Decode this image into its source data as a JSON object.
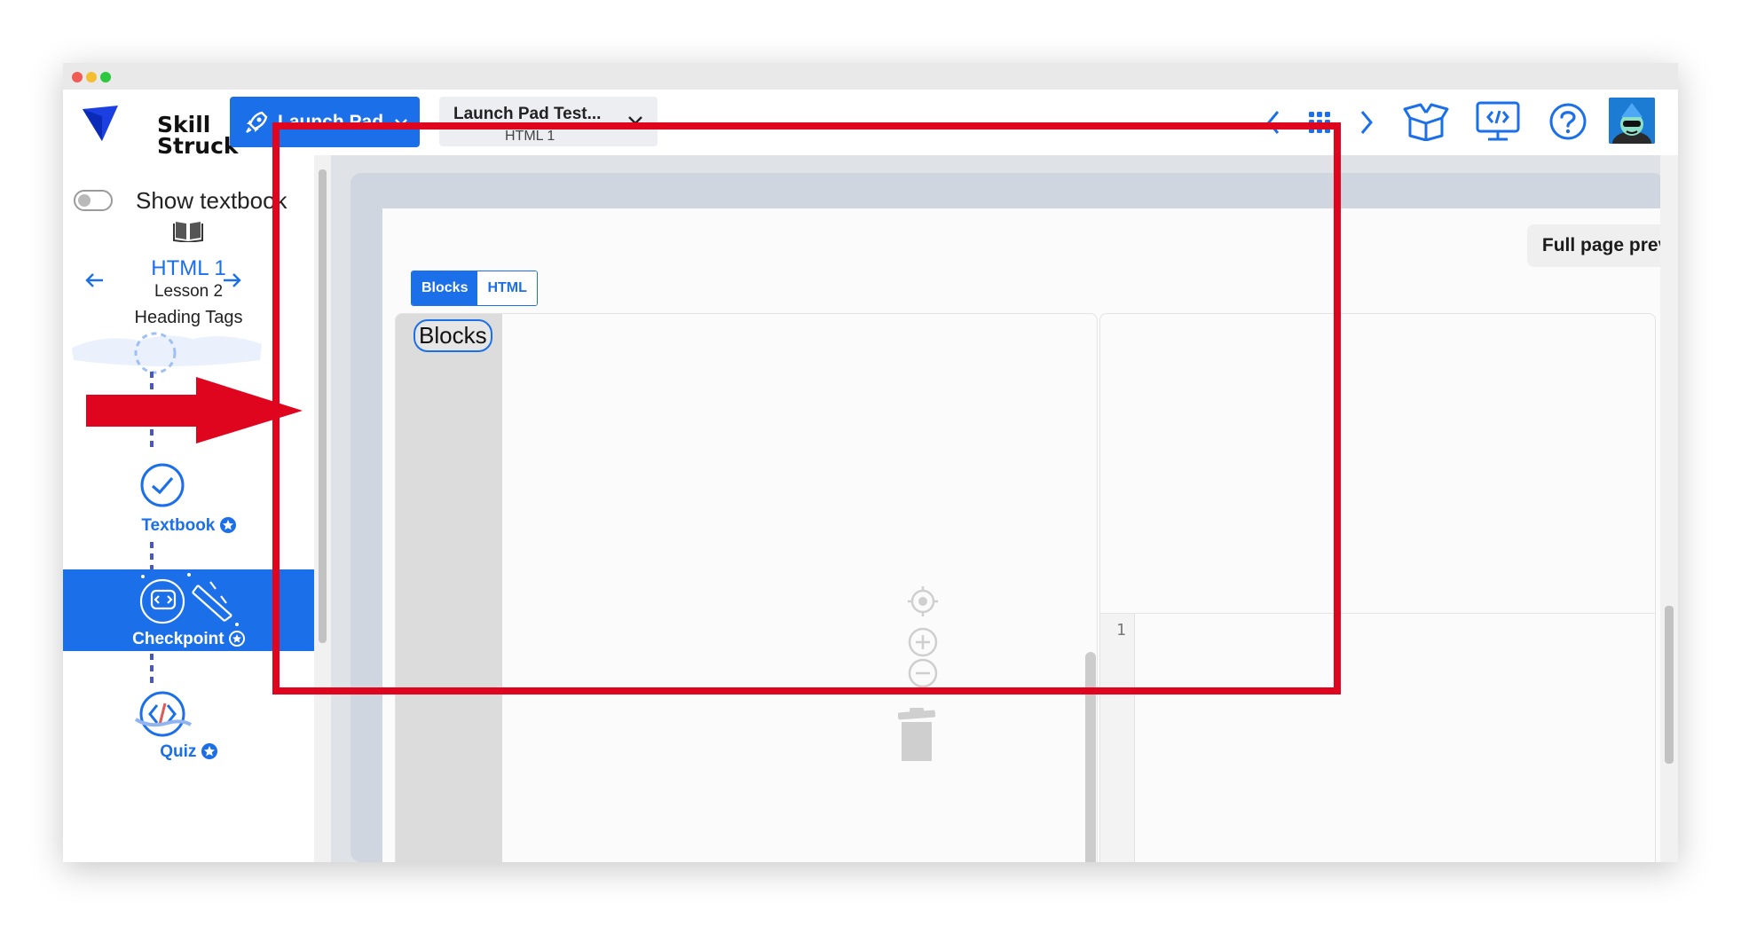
{
  "brand": {
    "name_line1": "Skill",
    "name_line2": "Struck"
  },
  "header": {
    "launch_pad_label": "Launch Pad",
    "lesson_select_title": "Launch Pad Test...",
    "lesson_select_subtitle": "HTML 1"
  },
  "sidebar": {
    "show_textbook_label": "Show textbook",
    "course_title": "HTML 1",
    "lesson_label": "Lesson 2",
    "current_topic": "Heading Tags",
    "steps": [
      {
        "label": "Textbook"
      },
      {
        "label": "Checkpoint"
      },
      {
        "label": "Quiz"
      }
    ]
  },
  "editor": {
    "full_page_preview_label": "Full page preview",
    "tabs": [
      {
        "label": "Blocks"
      },
      {
        "label": "HTML"
      }
    ],
    "active_tab": "Blocks",
    "toolbox_category": "Blocks",
    "line_number": "1"
  },
  "colors": {
    "accent": "#1b6fe8",
    "annotation_red": "#e0051f",
    "toolbox_gray": "#dcdcdc"
  },
  "icons": {
    "traffic_lights": [
      "close-dot",
      "minimize-dot",
      "maximize-dot"
    ],
    "header_right": [
      "chevron-left-icon",
      "grid-icon",
      "chevron-right-icon",
      "open-box-icon",
      "code-monitor-icon",
      "help-icon"
    ]
  }
}
